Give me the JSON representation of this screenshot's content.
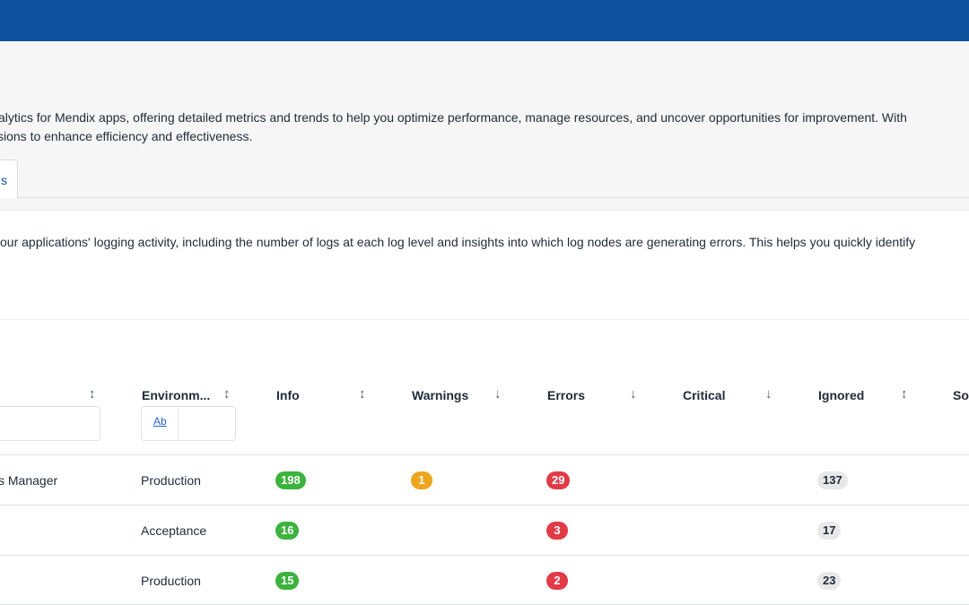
{
  "header": {
    "intro_line1": "alytics for Mendix apps, offering detailed metrics and trends to help you optimize performance, manage resources, and uncover opportunities for improvement. With",
    "intro_line2": "sions to enhance efficiency and effectiveness."
  },
  "tab": {
    "label": "s"
  },
  "panel": {
    "description": "our applications' logging activity, including the number of logs at each log level and insights into which log nodes are generating errors. This helps you quickly identify"
  },
  "table": {
    "columns": {
      "environment": "Environm...",
      "info": "Info",
      "warnings": "Warnings",
      "errors": "Errors",
      "critical": "Critical",
      "ignored": "Ignored",
      "last": "So"
    },
    "filter_type_label": "Ab",
    "rows": [
      {
        "name": "s Manager",
        "environment": "Production",
        "info": "198",
        "warnings": "1",
        "errors": "29",
        "critical": "",
        "ignored": "137"
      },
      {
        "name": "",
        "environment": "Acceptance",
        "info": "16",
        "warnings": "",
        "errors": "3",
        "critical": "",
        "ignored": "17"
      },
      {
        "name": "",
        "environment": "Production",
        "info": "15",
        "warnings": "",
        "errors": "2",
        "critical": "",
        "ignored": "23"
      }
    ]
  },
  "colors": {
    "topbar": "#0e519d",
    "info": "#3cb33d",
    "warnings": "#eca51c",
    "errors": "#e13b47",
    "ignored": "#e8e8ea"
  },
  "icons": {
    "sort_both": "sort-both-icon",
    "sort_down": "sort-descending-icon"
  }
}
